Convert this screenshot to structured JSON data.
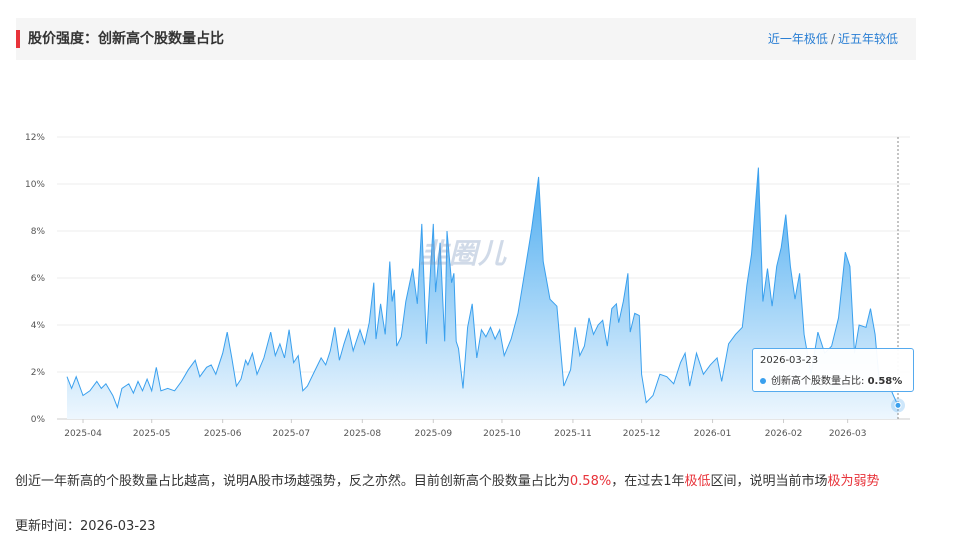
{
  "header": {
    "title": "股价强度：创新高个股数量占比",
    "link_year": "近一年极低",
    "separator": "/",
    "link_five": "近五年较低"
  },
  "watermark": "韭圈儿",
  "tooltip": {
    "date": "2026-03-23",
    "series_label": "创新高个股数量占比:",
    "value": "0.58%"
  },
  "description": {
    "part1": "创近一年新高的个股数量占比越高，说明A股市场越强势，反之亦然。目前创新高个股数量占比为",
    "value": "0.58%",
    "part2": "，在过去1年",
    "level": "极低",
    "part3": "区间，说明当前市场",
    "conclusion": "极为弱势"
  },
  "update": {
    "label": "更新时间：",
    "date": "2026-03-23"
  },
  "colors": {
    "line": "#3aa0ee",
    "area_top": "#48aaf0",
    "area_bottom": "#eef7fe",
    "highlight": "#e8333a",
    "link": "#2a7fd4"
  },
  "chart_data": {
    "type": "area",
    "ylim": [
      0,
      12
    ],
    "yticks": [
      "0%",
      "2%",
      "4%",
      "6%",
      "8%",
      "10%",
      "12%"
    ],
    "xticks": [
      "2025-04",
      "2025-05",
      "2025-06",
      "2025-07",
      "2025-08",
      "2025-09",
      "2025-10",
      "2025-11",
      "2025-12",
      "2026-01",
      "2026-02",
      "2026-03"
    ],
    "grid": true,
    "x_range": [
      "2025-03-25",
      "2026-03-23"
    ],
    "series": [
      {
        "points": [
          [
            "2025-03-25",
            1.8
          ],
          [
            "2025-03-27",
            1.3
          ],
          [
            "2025-03-29",
            1.8
          ],
          [
            "2025-04-01",
            1.0
          ],
          [
            "2025-04-04",
            1.2
          ],
          [
            "2025-04-07",
            1.6
          ],
          [
            "2025-04-09",
            1.3
          ],
          [
            "2025-04-11",
            1.5
          ],
          [
            "2025-04-14",
            1.0
          ],
          [
            "2025-04-16",
            0.5
          ],
          [
            "2025-04-18",
            1.3
          ],
          [
            "2025-04-21",
            1.5
          ],
          [
            "2025-04-23",
            1.1
          ],
          [
            "2025-04-25",
            1.6
          ],
          [
            "2025-04-27",
            1.2
          ],
          [
            "2025-04-29",
            1.7
          ],
          [
            "2025-05-01",
            1.2
          ],
          [
            "2025-05-03",
            2.2
          ],
          [
            "2025-05-05",
            1.2
          ],
          [
            "2025-05-08",
            1.3
          ],
          [
            "2025-05-11",
            1.2
          ],
          [
            "2025-05-14",
            1.6
          ],
          [
            "2025-05-17",
            2.1
          ],
          [
            "2025-05-20",
            2.5
          ],
          [
            "2025-05-22",
            1.8
          ],
          [
            "2025-05-25",
            2.2
          ],
          [
            "2025-05-27",
            2.3
          ],
          [
            "2025-05-29",
            1.9
          ],
          [
            "2025-06-01",
            2.8
          ],
          [
            "2025-06-03",
            3.7
          ],
          [
            "2025-06-05",
            2.6
          ],
          [
            "2025-06-07",
            1.4
          ],
          [
            "2025-06-09",
            1.7
          ],
          [
            "2025-06-11",
            2.5
          ],
          [
            "2025-06-12",
            2.3
          ],
          [
            "2025-06-14",
            2.8
          ],
          [
            "2025-06-16",
            1.9
          ],
          [
            "2025-06-19",
            2.6
          ],
          [
            "2025-06-22",
            3.7
          ],
          [
            "2025-06-24",
            2.7
          ],
          [
            "2025-06-26",
            3.2
          ],
          [
            "2025-06-28",
            2.6
          ],
          [
            "2025-06-30",
            3.8
          ],
          [
            "2025-07-02",
            2.4
          ],
          [
            "2025-07-04",
            2.7
          ],
          [
            "2025-07-06",
            1.2
          ],
          [
            "2025-07-08",
            1.4
          ],
          [
            "2025-07-11",
            2.0
          ],
          [
            "2025-07-14",
            2.6
          ],
          [
            "2025-07-16",
            2.3
          ],
          [
            "2025-07-18",
            2.9
          ],
          [
            "2025-07-20",
            3.9
          ],
          [
            "2025-07-22",
            2.5
          ],
          [
            "2025-07-24",
            3.2
          ],
          [
            "2025-07-26",
            3.8
          ],
          [
            "2025-07-28",
            2.9
          ],
          [
            "2025-07-31",
            3.8
          ],
          [
            "2025-08-02",
            3.2
          ],
          [
            "2025-08-04",
            4.1
          ],
          [
            "2025-08-06",
            5.8
          ],
          [
            "2025-08-07",
            3.4
          ],
          [
            "2025-08-09",
            4.9
          ],
          [
            "2025-08-11",
            3.6
          ],
          [
            "2025-08-13",
            6.7
          ],
          [
            "2025-08-14",
            5.0
          ],
          [
            "2025-08-15",
            5.5
          ],
          [
            "2025-08-16",
            3.1
          ],
          [
            "2025-08-18",
            3.5
          ],
          [
            "2025-08-20",
            5.0
          ],
          [
            "2025-08-23",
            6.4
          ],
          [
            "2025-08-25",
            4.9
          ],
          [
            "2025-08-27",
            8.3
          ],
          [
            "2025-08-29",
            3.2
          ],
          [
            "2025-08-31",
            6.7
          ],
          [
            "2025-09-01",
            8.3
          ],
          [
            "2025-09-02",
            5.4
          ],
          [
            "2025-09-04",
            7.5
          ],
          [
            "2025-09-06",
            3.3
          ],
          [
            "2025-09-07",
            8.0
          ],
          [
            "2025-09-09",
            5.8
          ],
          [
            "2025-09-10",
            6.2
          ],
          [
            "2025-09-11",
            3.3
          ],
          [
            "2025-09-12",
            3.0
          ],
          [
            "2025-09-14",
            1.3
          ],
          [
            "2025-09-16",
            3.9
          ],
          [
            "2025-09-18",
            4.9
          ],
          [
            "2025-09-20",
            2.6
          ],
          [
            "2025-09-22",
            3.8
          ],
          [
            "2025-09-24",
            3.5
          ],
          [
            "2025-09-26",
            3.9
          ],
          [
            "2025-09-28",
            3.4
          ],
          [
            "2025-09-30",
            3.8
          ],
          [
            "2025-10-02",
            2.7
          ],
          [
            "2025-10-05",
            3.4
          ],
          [
            "2025-10-08",
            4.5
          ],
          [
            "2025-10-11",
            6.3
          ],
          [
            "2025-10-14",
            8.1
          ],
          [
            "2025-10-17",
            10.3
          ],
          [
            "2025-10-19",
            6.7
          ],
          [
            "2025-10-22",
            5.1
          ],
          [
            "2025-10-25",
            4.8
          ],
          [
            "2025-10-28",
            1.4
          ],
          [
            "2025-10-31",
            2.1
          ],
          [
            "2025-11-02",
            3.9
          ],
          [
            "2025-11-04",
            2.7
          ],
          [
            "2025-11-06",
            3.1
          ],
          [
            "2025-11-08",
            4.3
          ],
          [
            "2025-11-10",
            3.6
          ],
          [
            "2025-11-12",
            4.0
          ],
          [
            "2025-11-14",
            4.2
          ],
          [
            "2025-11-16",
            3.1
          ],
          [
            "2025-11-18",
            4.7
          ],
          [
            "2025-11-20",
            4.9
          ],
          [
            "2025-11-21",
            4.1
          ],
          [
            "2025-11-23",
            5.0
          ],
          [
            "2025-11-25",
            6.2
          ],
          [
            "2025-11-26",
            3.7
          ],
          [
            "2025-11-28",
            4.5
          ],
          [
            "2025-11-30",
            4.4
          ],
          [
            "2025-12-01",
            1.9
          ],
          [
            "2025-12-03",
            0.7
          ],
          [
            "2025-12-06",
            1.0
          ],
          [
            "2025-12-09",
            1.9
          ],
          [
            "2025-12-12",
            1.8
          ],
          [
            "2025-12-15",
            1.5
          ],
          [
            "2025-12-18",
            2.4
          ],
          [
            "2025-12-20",
            2.8
          ],
          [
            "2025-12-22",
            1.4
          ],
          [
            "2025-12-25",
            2.8
          ],
          [
            "2025-12-28",
            1.9
          ],
          [
            "2025-12-31",
            2.3
          ],
          [
            "2026-01-03",
            2.6
          ],
          [
            "2026-01-05",
            1.6
          ],
          [
            "2026-01-08",
            3.2
          ],
          [
            "2026-01-11",
            3.6
          ],
          [
            "2026-01-14",
            3.9
          ],
          [
            "2026-01-16",
            5.7
          ],
          [
            "2026-01-18",
            7.0
          ],
          [
            "2026-01-21",
            10.7
          ],
          [
            "2026-01-23",
            5.0
          ],
          [
            "2026-01-25",
            6.4
          ],
          [
            "2026-01-27",
            4.8
          ],
          [
            "2026-01-29",
            6.5
          ],
          [
            "2026-01-31",
            7.3
          ],
          [
            "2026-02-02",
            8.7
          ],
          [
            "2026-02-04",
            6.5
          ],
          [
            "2026-02-06",
            5.1
          ],
          [
            "2026-02-08",
            6.2
          ],
          [
            "2026-02-10",
            3.6
          ],
          [
            "2026-02-13",
            1.9
          ],
          [
            "2026-02-16",
            3.7
          ],
          [
            "2026-02-19",
            2.8
          ],
          [
            "2026-02-22",
            3.1
          ],
          [
            "2026-02-25",
            4.3
          ],
          [
            "2026-02-28",
            7.1
          ],
          [
            "2026-03-02",
            6.5
          ],
          [
            "2026-03-04",
            2.8
          ],
          [
            "2026-03-06",
            4.0
          ],
          [
            "2026-03-09",
            3.9
          ],
          [
            "2026-03-11",
            4.7
          ],
          [
            "2026-03-13",
            3.6
          ],
          [
            "2026-03-15",
            1.4
          ],
          [
            "2026-03-18",
            1.7
          ],
          [
            "2026-03-21",
            1.0
          ],
          [
            "2026-03-23",
            0.58
          ]
        ]
      }
    ]
  }
}
